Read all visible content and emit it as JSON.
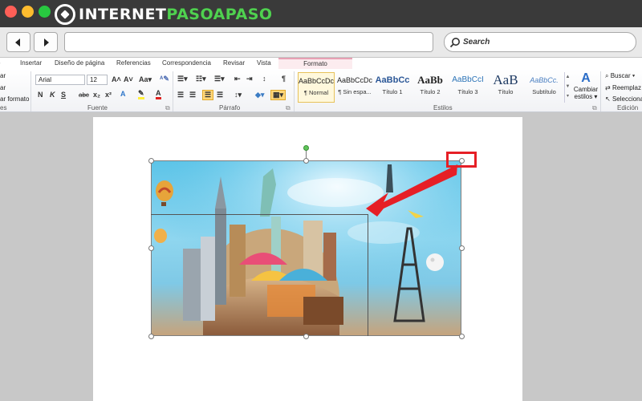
{
  "browser": {
    "logo_prefix": "INTERNET",
    "logo_accent": "PASOAPASO",
    "search_placeholder": "Search",
    "traffic_lights": [
      "#ff5f57",
      "#febc2e",
      "#28c840"
    ],
    "icons": [
      "back-arrow-icon",
      "forward-arrow-icon",
      "magnifier-icon"
    ]
  },
  "ribbon": {
    "tabs": [
      "Insertar",
      "Diseño de página",
      "Referencias",
      "Correspondencia",
      "Revisar",
      "Vista"
    ],
    "context_tab": "Formato",
    "clipboard": {
      "items": [
        "ar",
        "ar",
        "ar formato"
      ],
      "group_label": "es"
    },
    "font": {
      "family": "Arial",
      "size": "12",
      "group_label": "Fuente",
      "buttons": [
        "N",
        "K",
        "S",
        "abc",
        "x₂",
        "x²",
        "A",
        "A"
      ]
    },
    "paragraph": {
      "group_label": "Párrafo"
    },
    "styles": {
      "group_label": "Estilos",
      "items": [
        {
          "preview": "AaBbCcDc",
          "name": "¶ Normal"
        },
        {
          "preview": "AaBbCcDc",
          "name": "¶ Sin espa..."
        },
        {
          "preview": "AaBbCc",
          "name": "Título 1"
        },
        {
          "preview": "AaBb",
          "name": "Título 2"
        },
        {
          "preview": "AaBbCcI",
          "name": "Título 3"
        },
        {
          "preview": "AaB",
          "name": "Título"
        },
        {
          "preview": "AaBbCc.",
          "name": "Subtítulo"
        }
      ],
      "change_label": "Cambiar",
      "change_label2": "estilos ▾"
    },
    "editing": {
      "group_label": "Edición",
      "items": [
        "Buscar ▾",
        "Reemplaz",
        "Selecciona"
      ]
    }
  },
  "colors": {
    "accent_green": "#4fd14f",
    "highlight_red": "#e61f26",
    "context_tab_pink": "#fcecef"
  }
}
